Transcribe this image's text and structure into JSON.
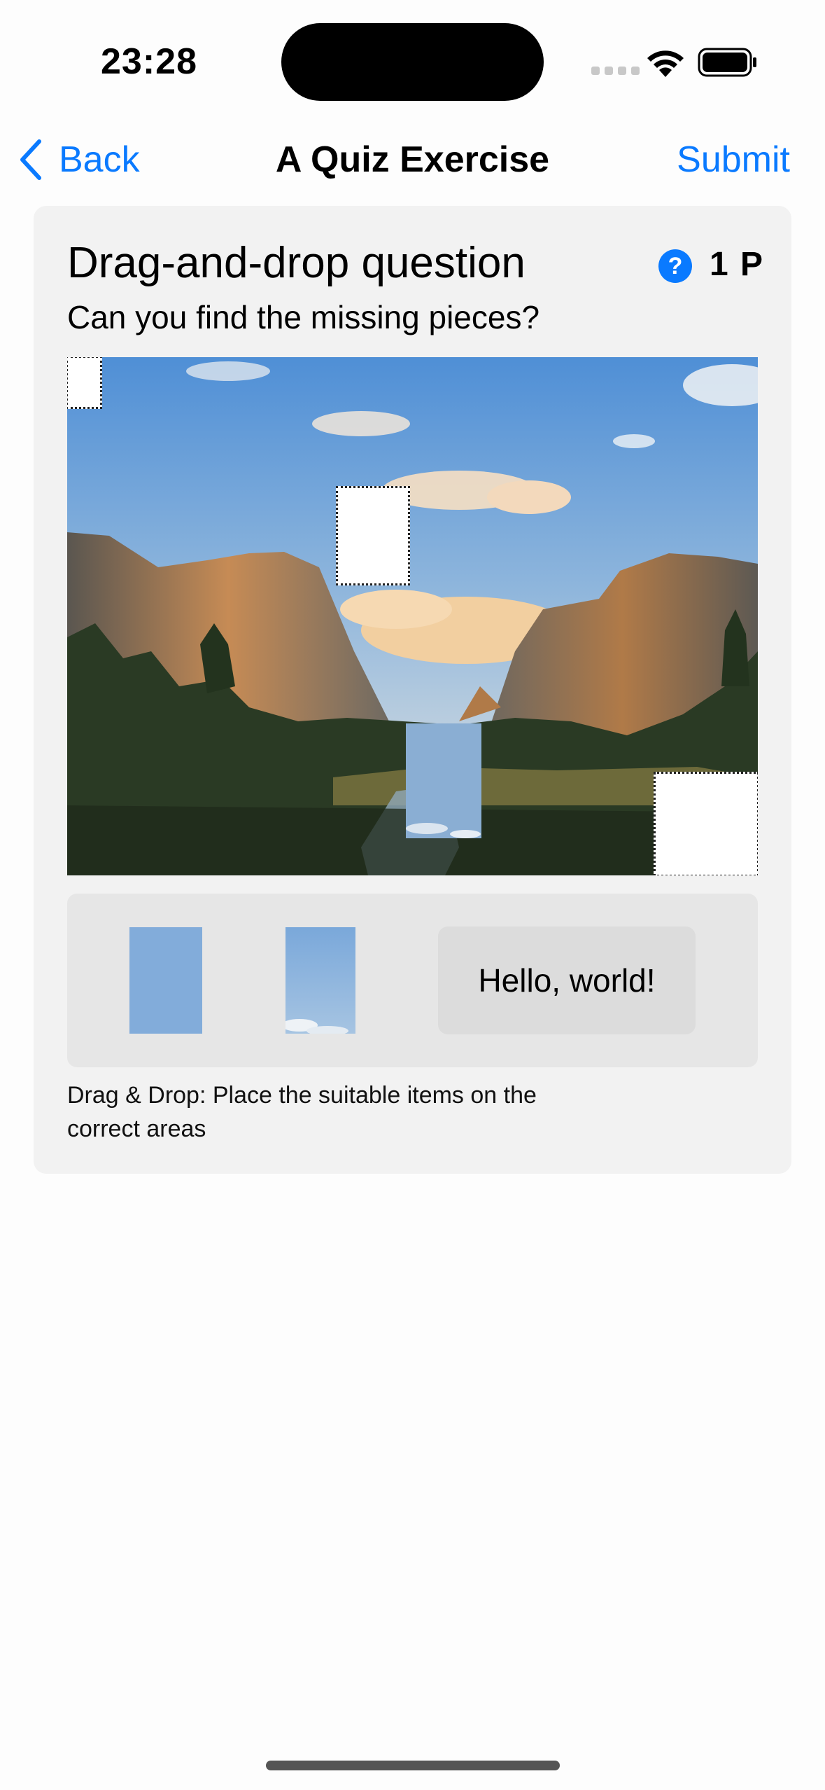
{
  "status_bar": {
    "time": "23:28"
  },
  "nav": {
    "back_label": "Back",
    "title": "A Quiz Exercise",
    "submit_label": "Submit"
  },
  "question": {
    "title": "Drag-and-drop question",
    "subtitle": "Can you find the missing pieces?",
    "help_symbol": "?",
    "points": "1 P",
    "image_description": "mountain-valley-landscape-with-sky",
    "drop_zones_total": 4,
    "drop_zones_filled": 1
  },
  "drag_items": {
    "text_item": "Hello, world!",
    "image_items": [
      "sky-piece-plain",
      "sky-piece-clouds"
    ]
  },
  "hint": "Drag & Drop: Place the suitable items on the correct areas",
  "colors": {
    "accent": "#0a7aff",
    "card": "#f2f2f2",
    "tray": "#e6e6e6"
  }
}
